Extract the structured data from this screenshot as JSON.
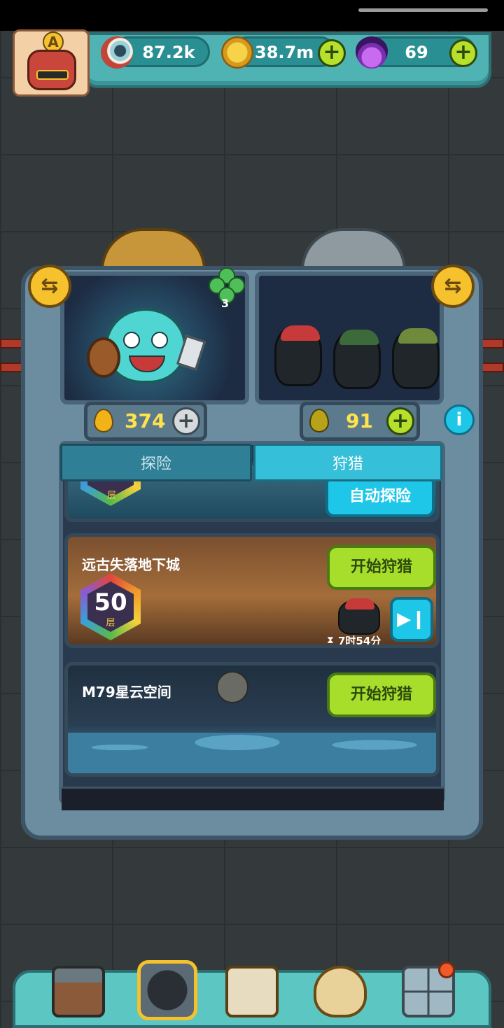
{
  "player": {
    "rank_letter": "A"
  },
  "resources": [
    {
      "name": "eyeball-icon",
      "value": "87.2k",
      "has_plus": false
    },
    {
      "name": "gold-coin-icon",
      "value": "38.7m",
      "has_plus": true
    },
    {
      "name": "potion-icon",
      "value": "69",
      "has_plus": true
    }
  ],
  "clover": {
    "count": "3"
  },
  "energy": {
    "left": {
      "value": "374"
    },
    "right": {
      "value": "91"
    }
  },
  "tabs": [
    {
      "label": "探险",
      "active": false
    },
    {
      "label": "狩猎",
      "active": true
    }
  ],
  "partial_card": {
    "badge_suffix": "层",
    "button": "自动探险"
  },
  "dungeons": [
    {
      "title": "远古失落地下城",
      "floor": "50",
      "floor_suffix": "层",
      "button": "开始狩猎",
      "timer": "7时54分"
    },
    {
      "title": "M79星云空间",
      "button": "开始狩猎"
    }
  ],
  "bottom_nav": [
    {
      "name": "shop-building-icon"
    },
    {
      "name": "monster-hero-icon"
    },
    {
      "name": "book-icon"
    },
    {
      "name": "coin-bag-icon"
    },
    {
      "name": "grid-menu-icon",
      "has_notification": true
    }
  ],
  "colors": {
    "accent_green": "#a7de2c",
    "accent_blue": "#1ec7e8",
    "gold": "#ffe34d"
  }
}
